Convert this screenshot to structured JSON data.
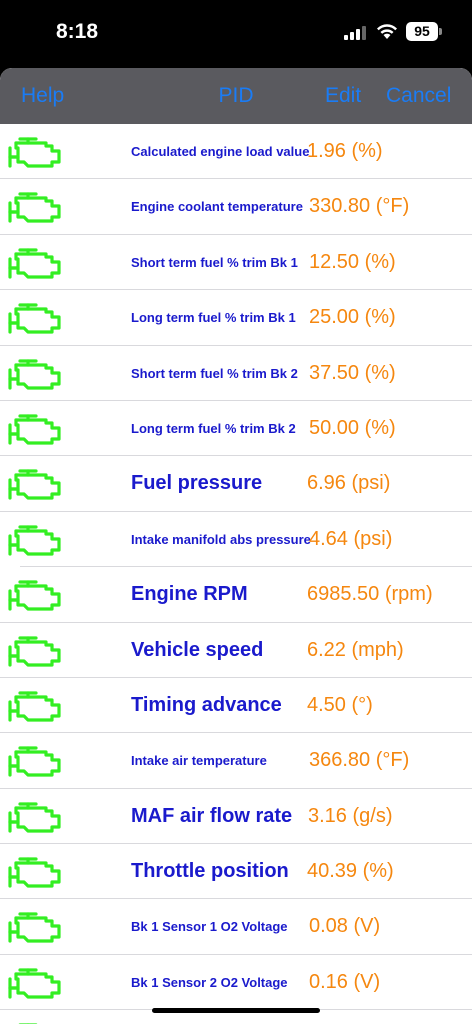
{
  "status_bar": {
    "time": "8:18",
    "battery": "95"
  },
  "navbar": {
    "help": "Help",
    "title": "PID",
    "edit": "Edit",
    "cancel": "Cancel"
  },
  "colors": {
    "accent_blue": "#1a7cf5",
    "label_blue": "#1a1acc",
    "value_orange": "#f5870f",
    "icon_green": "#33ee22"
  },
  "rows": [
    {
      "label": "Calculated engine load value",
      "value": "1.96 (%)",
      "icon": "engine-icon"
    },
    {
      "label": "Engine coolant temperature",
      "value": "330.80 (°F)",
      "icon": "engine-icon"
    },
    {
      "label": "Short term fuel % trim Bk 1",
      "value": "12.50 (%)",
      "icon": "engine-icon"
    },
    {
      "label": "Long term fuel % trim Bk 1",
      "value": "25.00 (%)",
      "icon": "engine-icon"
    },
    {
      "label": "Short term fuel % trim Bk 2",
      "value": "37.50 (%)",
      "icon": "engine-icon"
    },
    {
      "label": "Long term fuel % trim Bk 2",
      "value": "50.00 (%)",
      "icon": "engine-icon"
    },
    {
      "label": "Fuel pressure",
      "value": "6.96 (psi)",
      "icon": "engine-icon"
    },
    {
      "label": "Intake manifold abs pressure",
      "value": "4.64 (psi)",
      "icon": "engine-icon"
    },
    {
      "label": "Engine RPM",
      "value": "6985.50 (rpm)",
      "icon": "engine-icon"
    },
    {
      "label": "Vehicle speed",
      "value": "6.22 (mph)",
      "icon": "engine-icon"
    },
    {
      "label": "Timing advance",
      "value": "4.50 (°)",
      "icon": "engine-icon"
    },
    {
      "label": "Intake air temperature",
      "value": "366.80 (°F)",
      "icon": "engine-icon"
    },
    {
      "label": "MAF air flow rate",
      "value": "3.16 (g/s)",
      "icon": "engine-icon"
    },
    {
      "label": "Throttle position",
      "value": "40.39 (%)",
      "icon": "engine-icon"
    },
    {
      "label": "Bk 1 Sensor 1 O2 Voltage",
      "value": "0.08 (V)",
      "icon": "engine-icon"
    },
    {
      "label": "Bk 1 Sensor 2 O2 Voltage",
      "value": "0.16 (V)",
      "icon": "engine-icon"
    }
  ]
}
